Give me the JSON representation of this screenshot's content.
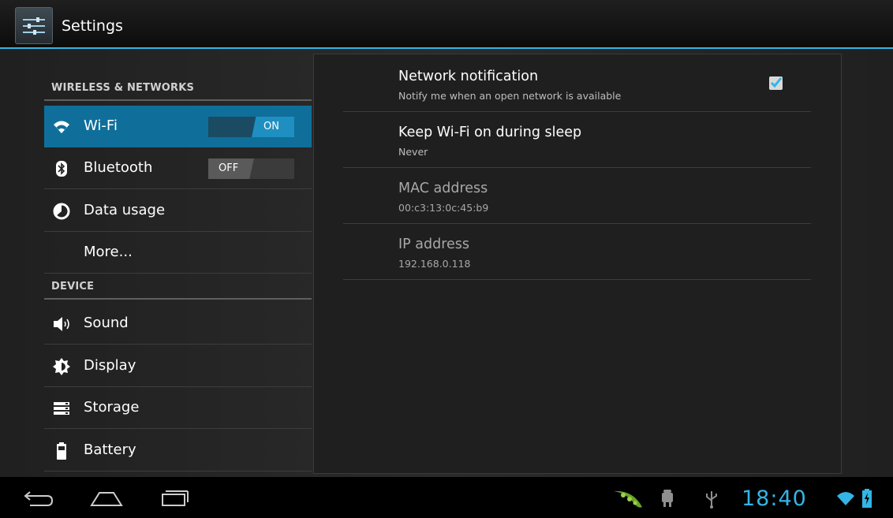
{
  "app": {
    "title": "Settings"
  },
  "sidebar": {
    "sections": [
      {
        "header": "WIRELESS & NETWORKS"
      },
      {
        "header": "DEVICE"
      }
    ],
    "items": [
      {
        "label": "Wi-Fi",
        "icon": "wifi-icon",
        "toggle": "ON",
        "selected": true
      },
      {
        "label": "Bluetooth",
        "icon": "bluetooth-icon",
        "toggle": "OFF"
      },
      {
        "label": "Data usage",
        "icon": "data-usage-icon"
      },
      {
        "label": "More..."
      },
      {
        "label": "Sound",
        "icon": "speaker-icon"
      },
      {
        "label": "Display",
        "icon": "brightness-icon"
      },
      {
        "label": "Storage",
        "icon": "storage-icon"
      },
      {
        "label": "Battery",
        "icon": "battery-icon"
      }
    ]
  },
  "detail": {
    "rows": [
      {
        "title": "Network notification",
        "summary": "Notify me when an open network is available",
        "checked": true
      },
      {
        "title": "Keep Wi-Fi on during sleep",
        "summary": "Never"
      },
      {
        "title": "MAC address",
        "summary": "00:c3:13:0c:45:b9"
      },
      {
        "title": "IP address",
        "summary": "192.168.0.118"
      }
    ]
  },
  "statusbar": {
    "time": "18:40"
  },
  "colors": {
    "accent": "#33b5e5",
    "selected": "#0f6f9a"
  }
}
